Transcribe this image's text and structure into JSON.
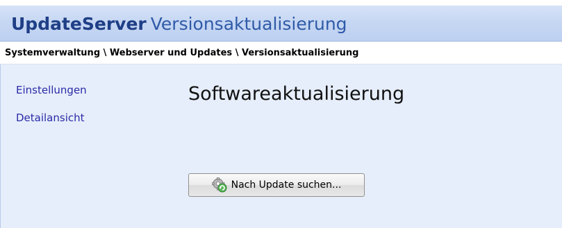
{
  "header": {
    "app_name": "UpdateServer",
    "subtitle": "Versionsaktualisierung"
  },
  "breadcrumb": "Systemverwaltung \\ Webserver und Updates \\ Versionsaktualisierung",
  "sidebar": {
    "items": [
      {
        "label": "Einstellungen"
      },
      {
        "label": "Detailansicht"
      }
    ]
  },
  "main": {
    "heading": "Softwareaktualisierung",
    "check_button": {
      "label": "Nach Update suchen...",
      "icon": "gear-update-icon"
    }
  },
  "colors": {
    "title_text": "#1f3f86",
    "link": "#2a2aa6",
    "background": "#e6eefb",
    "header_gradient_end": "#bdd0f1"
  }
}
